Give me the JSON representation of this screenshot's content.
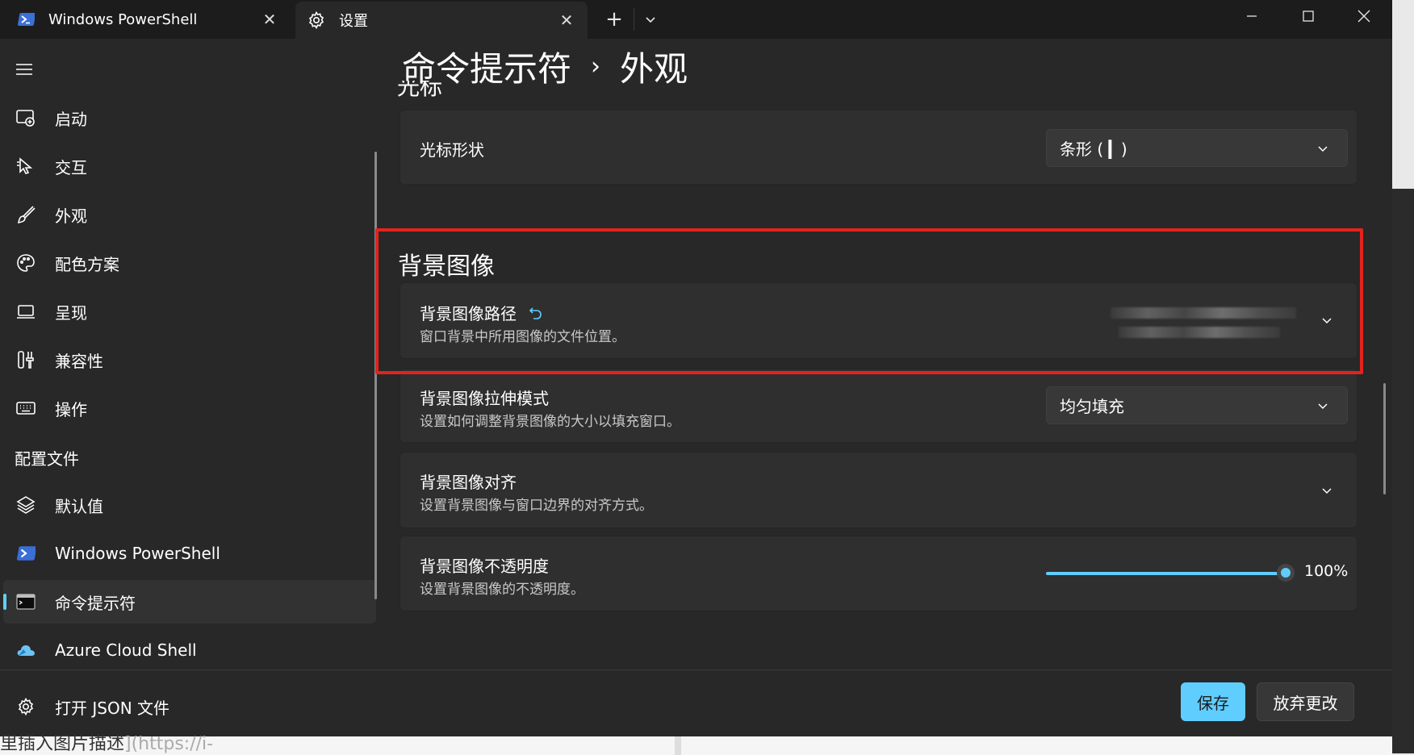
{
  "titlebar": {
    "tabs": [
      {
        "label": "Windows PowerShell",
        "icon": "powershell-icon"
      },
      {
        "label": "设置",
        "icon": "gear-icon"
      }
    ],
    "new_tab_label": "+",
    "dropdown_label": "⌄",
    "close_glyph": "✕"
  },
  "sidebar": {
    "items": [
      {
        "label": "启动",
        "icon": "startup-icon"
      },
      {
        "label": "交互",
        "icon": "pointer-icon"
      },
      {
        "label": "外观",
        "icon": "brush-icon"
      },
      {
        "label": "配色方案",
        "icon": "palette-icon"
      },
      {
        "label": "呈现",
        "icon": "monitor-icon"
      },
      {
        "label": "兼容性",
        "icon": "tools-icon"
      },
      {
        "label": "操作",
        "icon": "keyboard-icon"
      }
    ],
    "profiles_heading": "配置文件",
    "profiles": [
      {
        "label": "默认值",
        "icon": "layers-icon"
      },
      {
        "label": "Windows PowerShell",
        "icon": "powershell-icon"
      },
      {
        "label": "命令提示符",
        "icon": "cmd-icon",
        "selected": true
      },
      {
        "label": "Azure Cloud Shell",
        "icon": "azure-icon"
      }
    ],
    "open_json_label": "打开 JSON 文件"
  },
  "main": {
    "breadcrumb": {
      "parent": "命令提示符",
      "separator": "›",
      "current": "外观"
    },
    "cut_section_title": "光标",
    "cursor_shape": {
      "title": "光标形状",
      "value": "条形 ( ▎)"
    },
    "background_group_title": "背景图像",
    "bg_path": {
      "title": "背景图像路径",
      "desc": "窗口背景中所用图像的文件位置。"
    },
    "bg_stretch": {
      "title": "背景图像拉伸模式",
      "desc": "设置如何调整背景图像的大小以填充窗口。",
      "value": "均匀填充"
    },
    "bg_align": {
      "title": "背景图像对齐",
      "desc": "设置背景图像与窗口边界的对齐方式。"
    },
    "bg_opacity": {
      "title": "背景图像不透明度",
      "desc": "设置背景图像的不透明度。",
      "value": 100,
      "value_label": "100%"
    }
  },
  "footer": {
    "save_label": "保存",
    "discard_label": "放弃更改"
  },
  "outside": {
    "bottom_text": "里插入图片描述",
    "bottom_link": "](https://i-"
  },
  "colors": {
    "accent": "#60cdff",
    "highlight_box": "#e3231e",
    "background": "#282828"
  }
}
